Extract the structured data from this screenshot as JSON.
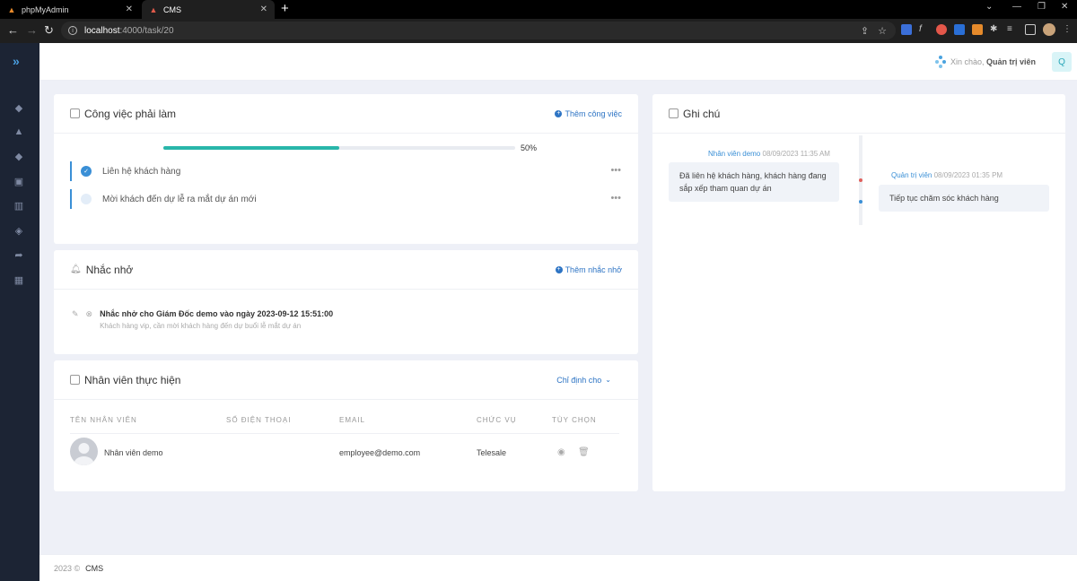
{
  "browser": {
    "tabs": [
      {
        "title": "phpMyAdmin"
      },
      {
        "title": "CMS"
      }
    ],
    "url_host": "localhost",
    "url_path": ":4000/task/20"
  },
  "header": {
    "greeting_prefix": "Xin chào,",
    "user_name": "Quản trị viên",
    "avatar_letter": "Q"
  },
  "tasks": {
    "title": "Công việc phải làm",
    "add_label": "Thêm công việc",
    "progress": 50,
    "progress_label": "50%",
    "items": [
      {
        "name": "Liên hệ khách hàng",
        "done": true
      },
      {
        "name": "Mời khách đến dự lễ ra mắt dự án mới",
        "done": false
      }
    ]
  },
  "reminders": {
    "title": "Nhắc nhở",
    "add_label": "Thêm nhắc nhở",
    "items": [
      {
        "title": "Nhắc nhở cho Giám Đốc demo vào ngày 2023-09-12 15:51:00",
        "description": "Khách hàng vip, cần mời khách hàng đến dự buổi lễ mắt dự án"
      }
    ]
  },
  "staff": {
    "title": "Nhân viên thực hiện",
    "assign_label": "Chỉ định cho",
    "columns": [
      "TÊN NHÂN VIÊN",
      "SỐ ĐIỆN THOẠI",
      "EMAIL",
      "CHỨC VỤ",
      "TÙY CHỌN"
    ],
    "rows": [
      {
        "name": "Nhân viên demo",
        "phone": "",
        "email": "employee@demo.com",
        "role": "Telesale"
      }
    ]
  },
  "notes": {
    "title": "Ghi chú",
    "items": [
      {
        "author": "Nhân viên demo",
        "time": "08/09/2023 11:35 AM",
        "text": "Đã liên hệ khách hàng, khách hàng đang sắp xếp tham quan dự án"
      },
      {
        "author": "Quản trị viên",
        "time": "08/09/2023 01:35 PM",
        "text": "Tiếp tục chăm sóc khách hàng"
      }
    ]
  },
  "footer": {
    "copyright": "2023 ©",
    "brand": "CMS"
  },
  "colors": {
    "accent": "#2d74c4",
    "progress": "#29b6aa",
    "sidebar": "#1c2434"
  }
}
